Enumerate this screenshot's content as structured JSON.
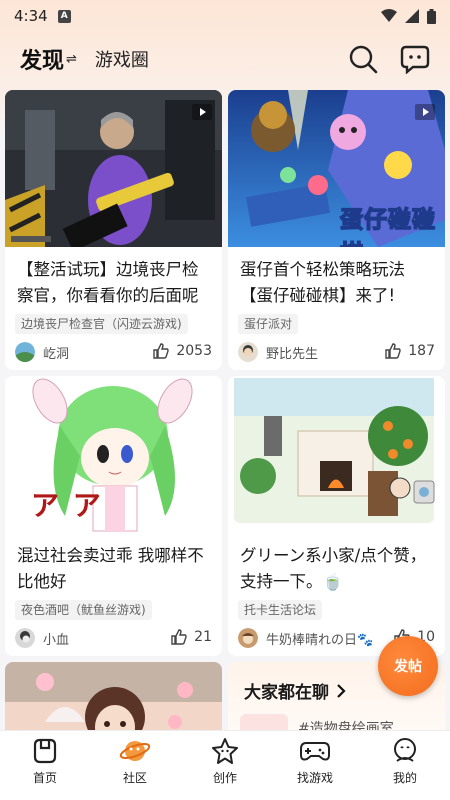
{
  "status_bar": {
    "time": "4:34",
    "badge": "A"
  },
  "header": {
    "active_tab": "发现",
    "swap_glyph": "⇌",
    "other_tab": "游戏圈"
  },
  "posts": [
    {
      "title": "【整活试玩】边境丧尸检察官，你看看你的后面呢",
      "tag": "边境丧尸检查官（闪迹云游戏)",
      "author": "屹洞",
      "likes": "2053"
    },
    {
      "title": "蛋仔首个轻松策略玩法【蛋仔碰碰棋】来了!",
      "tag": "蛋仔派对",
      "author": "野比先生",
      "likes": "187",
      "thumb_text": "蛋仔碰碰棋"
    },
    {
      "title": "混过社会卖过乖 我哪样不比他好",
      "tag": "夜色酒吧（鱿鱼丝游戏)",
      "author": "小血",
      "likes": "21",
      "thumb_text": "ア ア"
    },
    {
      "title": "グリーン系小家/点个赞，支持一下。🍵",
      "tag": "托卡生活论坛",
      "author": "牛奶棒晴れの日🐾",
      "likes": "10"
    },
    {
      "section_title": "大家都在聊",
      "preview": "#造物盘绘画室"
    }
  ],
  "fab_label": "发帖",
  "bottom_nav": [
    {
      "label": "首页"
    },
    {
      "label": "社区"
    },
    {
      "label": "创作"
    },
    {
      "label": "找游戏"
    },
    {
      "label": "我的"
    }
  ],
  "colors": {
    "accent": "#f36c1c",
    "background": "#f5f5f7"
  }
}
